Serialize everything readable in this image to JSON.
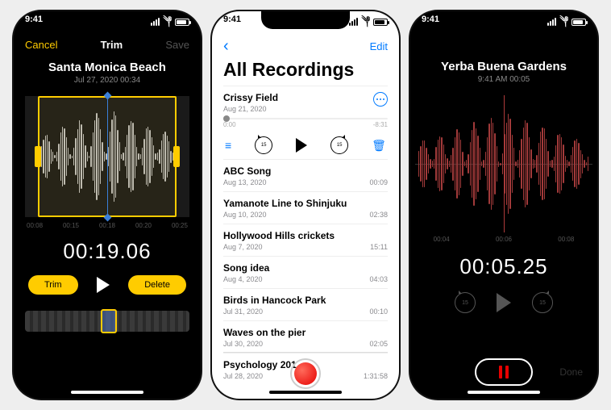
{
  "status": {
    "time": "9:41",
    "wifi": true,
    "signal": 4
  },
  "trim": {
    "cancel": "Cancel",
    "title": "Trim",
    "save": "Save",
    "recording_title": "Santa Monica Beach",
    "recording_sub": "Jul 27, 2020   00:34",
    "ticks": [
      "00:08",
      "00:15",
      "00:18",
      "00:20",
      "00:25"
    ],
    "time": "00:19.06",
    "trim_btn": "Trim",
    "delete_btn": "Delete"
  },
  "list": {
    "edit": "Edit",
    "heading": "All Recordings",
    "expanded": {
      "title": "Crissy Field",
      "date": "Aug 21, 2020",
      "pos": "0:00",
      "dur": "-8:31",
      "skip": "15"
    },
    "items": [
      {
        "title": "ABC Song",
        "date": "Aug 13, 2020",
        "dur": "00:09"
      },
      {
        "title": "Yamanote Line to Shinjuku",
        "date": "Aug 10, 2020",
        "dur": "02:38"
      },
      {
        "title": "Hollywood Hills crickets",
        "date": "Aug 7, 2020",
        "dur": "15:11"
      },
      {
        "title": "Song idea",
        "date": "Aug 4, 2020",
        "dur": "04:03"
      },
      {
        "title": "Birds in Hancock Park",
        "date": "Jul 31, 2020",
        "dur": "00:10"
      },
      {
        "title": "Waves on the pier",
        "date": "Jul 30, 2020",
        "dur": "02:05"
      },
      {
        "title": "Psychology 201",
        "date": "Jul 28, 2020",
        "dur": "1:31:58"
      }
    ]
  },
  "play": {
    "title": "Yerba Buena Gardens",
    "sub": "9:41 AM   00:05",
    "ticks": [
      "00:04",
      "00:06",
      "00:08"
    ],
    "time": "00:05.25",
    "skip": "15",
    "done": "Done"
  }
}
